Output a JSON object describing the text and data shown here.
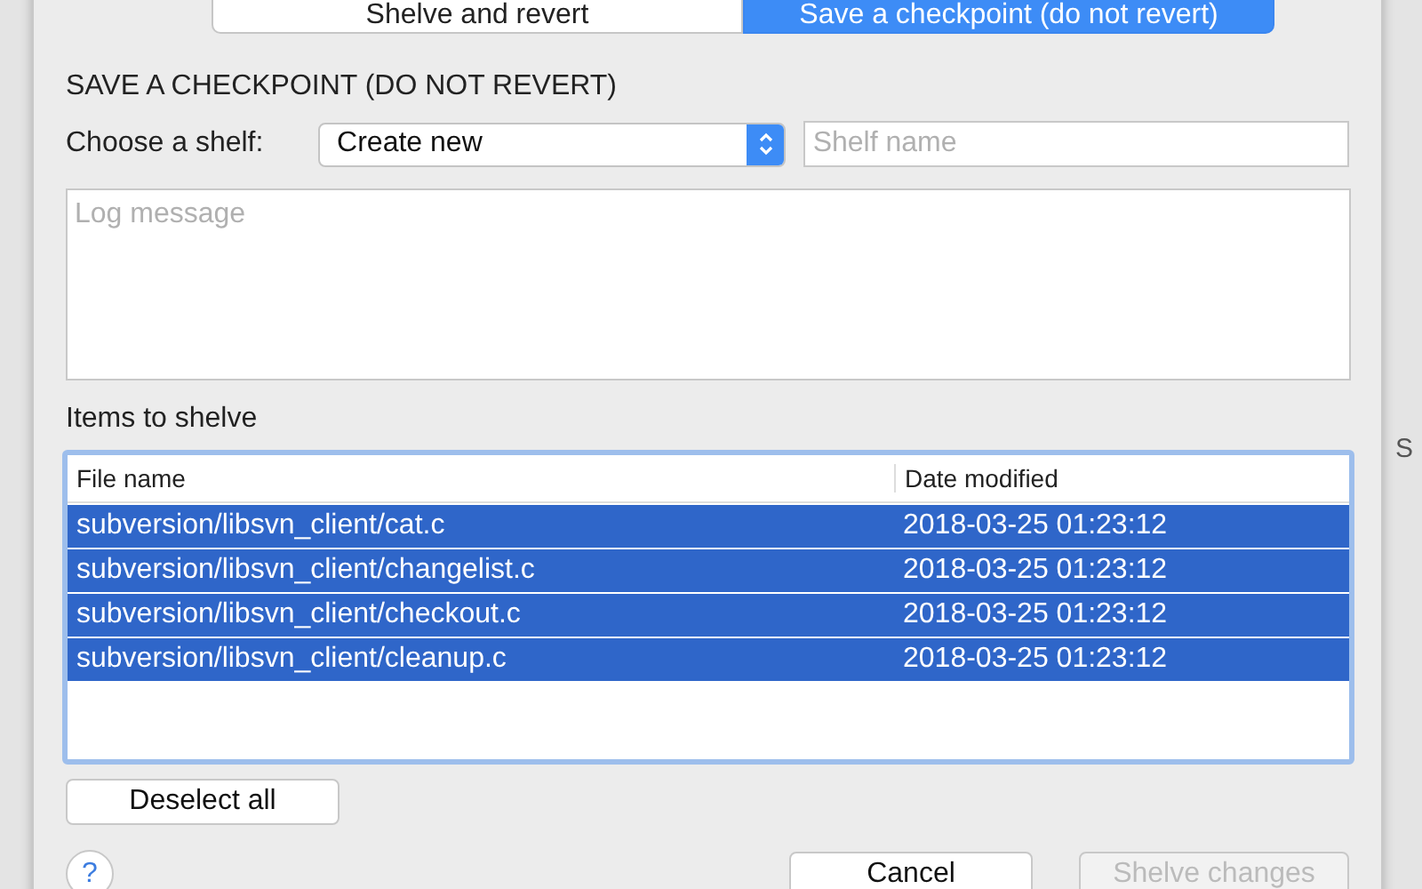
{
  "background": {
    "column_text": "S"
  },
  "tabs": [
    {
      "label": "Shelve and revert",
      "selected": false
    },
    {
      "label": "Save a checkpoint (do not revert)",
      "selected": true
    }
  ],
  "title": "SAVE A CHECKPOINT (DO NOT REVERT)",
  "shelf": {
    "label": "Choose a shelf:",
    "value": "Create new",
    "name_placeholder": "Shelf name"
  },
  "log": {
    "placeholder": "Log message"
  },
  "items_label": "Items to shelve",
  "table": {
    "columns": [
      "File name",
      "Date modified"
    ],
    "rows": [
      {
        "file": "subversion/libsvn_client/cat.c",
        "date": "2018-03-25 01:23:12",
        "selected": true
      },
      {
        "file": "subversion/libsvn_client/changelist.c",
        "date": "2018-03-25 01:23:12",
        "selected": true
      },
      {
        "file": "subversion/libsvn_client/checkout.c",
        "date": "2018-03-25 01:23:12",
        "selected": true
      },
      {
        "file": "subversion/libsvn_client/cleanup.c",
        "date": "2018-03-25 01:23:12",
        "selected": true
      }
    ]
  },
  "deselect_button": "Deselect all",
  "help": "?",
  "buttons": [
    {
      "label": "Cancel",
      "disabled": false
    },
    {
      "label": "Shelve changes",
      "disabled": true
    }
  ]
}
